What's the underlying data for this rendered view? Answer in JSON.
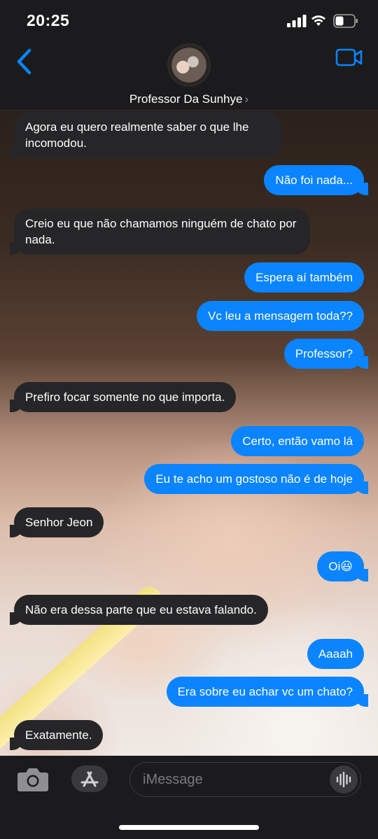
{
  "status_bar": {
    "time": "20:25"
  },
  "header": {
    "contact_name": "Professor Da Sunhye",
    "name_chevron": "›"
  },
  "messages": [
    {
      "dir": "recv",
      "text": "Agora eu quero realmente saber o que lhe incomodou."
    },
    {
      "dir": "sent",
      "text": "Não foi nada..."
    },
    {
      "dir": "recv",
      "text": "Creio eu que não chamamos ninguém de chato por nada."
    },
    {
      "dir": "sent",
      "text": "Espera aí também"
    },
    {
      "dir": "sent",
      "text": "Vc leu a mensagem toda??"
    },
    {
      "dir": "sent",
      "text": "Professor?"
    },
    {
      "dir": "recv",
      "text": "Prefiro focar somente no que importa."
    },
    {
      "dir": "sent",
      "text": "Certo, então vamo lá"
    },
    {
      "dir": "sent",
      "text": "Eu te acho um gostoso não é de hoje"
    },
    {
      "dir": "recv",
      "text": "Senhor Jeon"
    },
    {
      "dir": "sent",
      "text": "Oi😃"
    },
    {
      "dir": "recv",
      "text": "Não era dessa parte que eu estava falando."
    },
    {
      "dir": "sent",
      "text": "Aaaah"
    },
    {
      "dir": "sent",
      "text": "Era sobre eu achar vc um chato?"
    },
    {
      "dir": "recv",
      "text": "Exatamente."
    }
  ],
  "input": {
    "placeholder": "iMessage"
  },
  "icons": {
    "back": "chevron-left-icon",
    "video": "video-camera-icon",
    "camera": "camera-icon",
    "appstore": "app-store-icon",
    "audio": "waveform-icon"
  },
  "colors": {
    "accent": "#0a84ff",
    "received_bubble": "#262628",
    "bar_background": "#1b1b1d"
  }
}
